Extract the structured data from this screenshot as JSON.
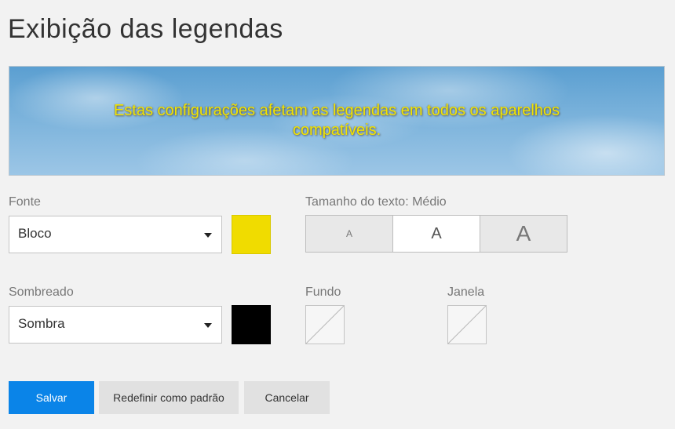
{
  "page": {
    "title": "Exibição das legendas"
  },
  "preview": {
    "caption": "Estas configurações afetam as legendas em todos os aparelhos compatíveis."
  },
  "font": {
    "label": "Fonte",
    "value": "Bloco",
    "color": "#f0dc00"
  },
  "text_size": {
    "label": "Tamanho do texto: Médio",
    "options": [
      {
        "label": "A",
        "size": "small",
        "selected": false
      },
      {
        "label": "A",
        "size": "medium",
        "selected": true
      },
      {
        "label": "A",
        "size": "large",
        "selected": false
      }
    ]
  },
  "shadow": {
    "label": "Sombreado",
    "value": "Sombra",
    "color": "#000000"
  },
  "background": {
    "label": "Fundo",
    "value": "none"
  },
  "window": {
    "label": "Janela",
    "value": "none"
  },
  "buttons": {
    "save": "Salvar",
    "reset": "Redefinir como padrão",
    "cancel": "Cancelar"
  },
  "colors": {
    "page_background": "#f2f2f2",
    "primary_button": "#0a84e8",
    "caption_text": "#f2e400"
  }
}
